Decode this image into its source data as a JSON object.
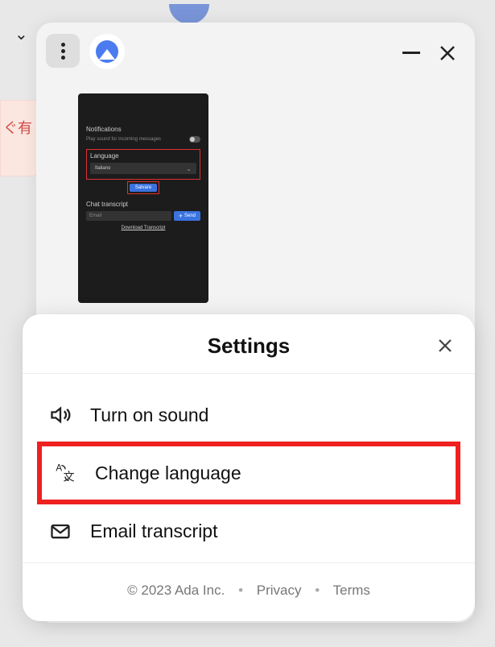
{
  "background": {
    "red_text": "ぐ有"
  },
  "chat_window": {
    "dark_panel": {
      "notifications": {
        "title": "Notifications",
        "sound_label": "Play sound for incoming messages"
      },
      "language": {
        "title": "Language",
        "selected": "Italiano",
        "save_label": "Salvare"
      },
      "transcript": {
        "title": "Chat transcript",
        "email_placeholder": "Email",
        "send_label": "Send",
        "download_label": "Download Transcript"
      }
    }
  },
  "settings": {
    "title": "Settings",
    "items": {
      "sound": {
        "label": "Turn on sound"
      },
      "language": {
        "label": "Change language"
      },
      "email": {
        "label": "Email transcript"
      }
    },
    "footer": {
      "copyright": "© 2023 Ada Inc.",
      "privacy": "Privacy",
      "terms": "Terms"
    }
  }
}
